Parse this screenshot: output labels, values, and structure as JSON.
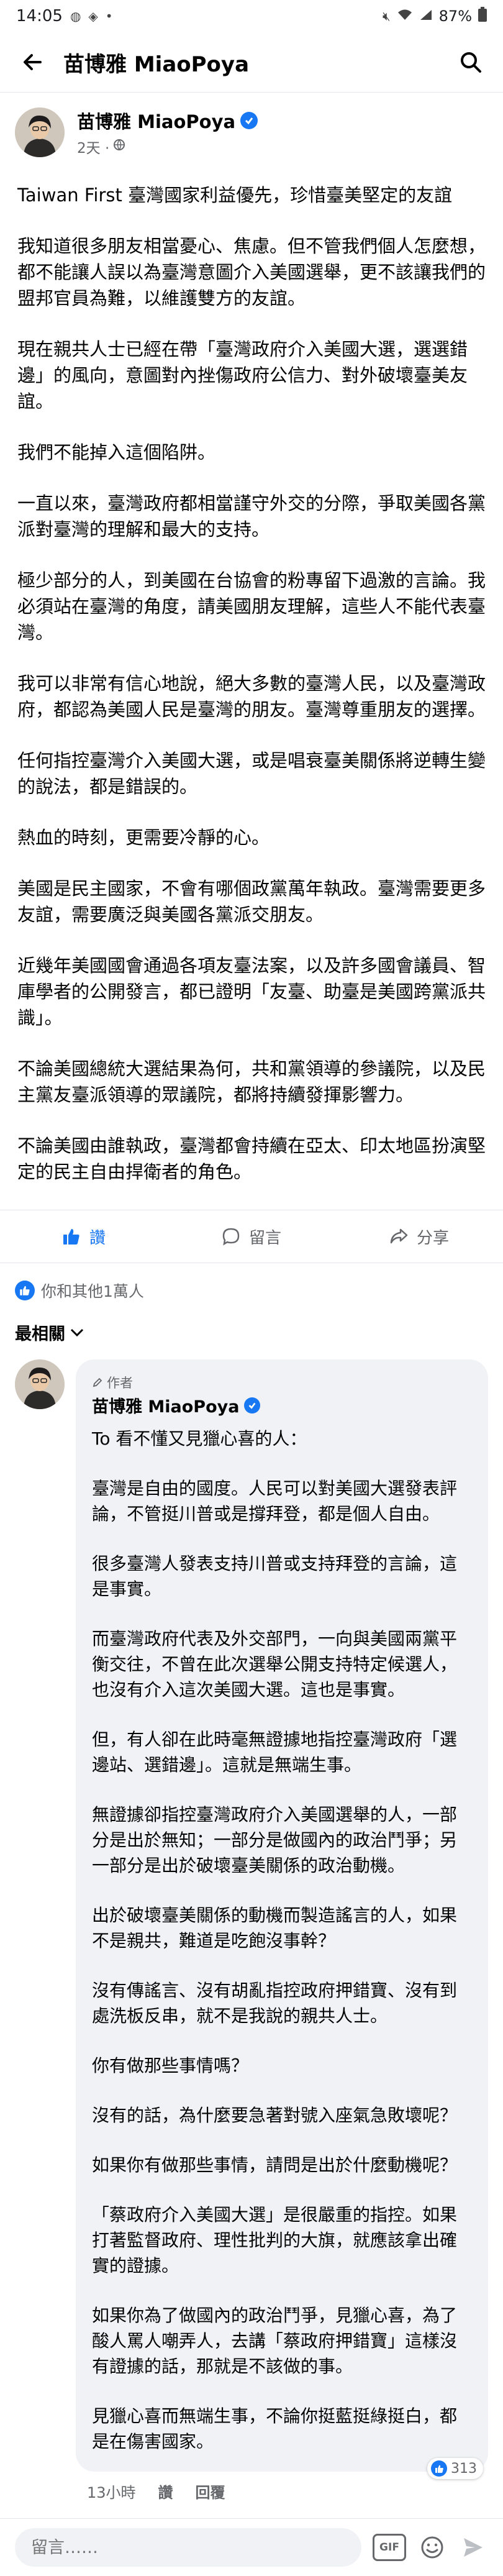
{
  "status_bar": {
    "time": "14:05",
    "battery": "87%"
  },
  "header": {
    "title": "苗博雅 MiaoPoya"
  },
  "post": {
    "author": "苗博雅 MiaoPoya",
    "time": "2天 ·",
    "paragraphs": [
      "Taiwan First 臺灣國家利益優先，珍惜臺美堅定的友誼",
      "我知道很多朋友相當憂心、焦慮。但不管我們個人怎麼想，都不能讓人誤以為臺灣意圖介入美國選舉，更不該讓我們的盟邦官員為難，以維護雙方的友誼。",
      "現在親共人士已經在帶「臺灣政府介入美國大選，選選錯邊」的風向，意圖對內挫傷政府公信力、對外破壞臺美友誼。",
      "我們不能掉入這個陷阱。",
      "一直以來，臺灣政府都相當謹守外交的分際，爭取美國各黨派對臺灣的理解和最大的支持。",
      "極少部分的人，到美國在台協會的粉專留下過激的言論。我必須站在臺灣的角度，請美國朋友理解，這些人不能代表臺灣。",
      "我可以非常有信心地說，絕大多數的臺灣人民，以及臺灣政府，都認為美國人民是臺灣的朋友。臺灣尊重朋友的選擇。",
      "任何指控臺灣介入美國大選，或是唱衰臺美關係將逆轉生變的說法，都是錯誤的。",
      "熱血的時刻，更需要冷靜的心。",
      "美國是民主國家，不會有哪個政黨萬年執政。臺灣需要更多友誼，需要廣泛與美國各黨派交朋友。",
      "近幾年美國國會通過各項友臺法案，以及許多國會議員、智庫學者的公開發言，都已證明「友臺、助臺是美國跨黨派共識」。",
      "不論美國總統大選結果為何，共和黨領導的參議院，以及民主黨友臺派領導的眾議院，都將持續發揮影響力。",
      "不論美國由誰執政，臺灣都會持續在亞太、印太地區扮演堅定的民主自由捍衛者的角色。"
    ]
  },
  "actions": {
    "like": "讚",
    "comment": "留言",
    "share": "分享"
  },
  "reactions": {
    "summary": "你和其他1萬人"
  },
  "sort": {
    "label": "最相關"
  },
  "comment": {
    "author_tag": "作者",
    "author": "苗博雅 MiaoPoya",
    "paragraphs": [
      "To 看不懂又見獵心喜的人：",
      "臺灣是自由的國度。人民可以對美國大選發表評論，不管挺川普或是撐拜登，都是個人自由。",
      "很多臺灣人發表支持川普或支持拜登的言論，這是事實。",
      "而臺灣政府代表及外交部門，一向與美國兩黨平衡交往，不曾在此次選舉公開支持特定候選人，也沒有介入這次美國大選。這也是事實。",
      "但，有人卻在此時毫無證據地指控臺灣政府「選邊站、選錯邊」。這就是無端生事。",
      "無證據卻指控臺灣政府介入美國選舉的人，一部分是出於無知；一部分是做國內的政治鬥爭；另一部分是出於破壞臺美關係的政治動機。",
      "出於破壞臺美關係的動機而製造謠言的人，如果不是親共，難道是吃飽沒事幹？",
      "沒有傳謠言、沒有胡亂指控政府押錯寶、沒有到處洗板反串，就不是我說的親共人士。",
      "你有做那些事情嗎？",
      "沒有的話，為什麼要急著對號入座氣急敗壞呢？",
      "如果你有做那些事情，請問是出於什麼動機呢？",
      "「蔡政府介入美國大選」是很嚴重的指控。如果打著監督政府、理性批判的大旗，就應該拿出確實的證據。",
      "如果你為了做國內的政治鬥爭，見獵心喜，為了酸人罵人嘲弄人，去講「蔡政府押錯寶」這樣沒有證據的話，那就是不該做的事。",
      "見獵心喜而無端生事，不論你挺藍挺綠挺白，都是在傷害國家。"
    ],
    "time": "13小時",
    "like_label": "讚",
    "reply_label": "回覆",
    "like_count": "313"
  },
  "composer": {
    "placeholder": "留言……",
    "gif_label": "GIF"
  },
  "colors": {
    "accent": "#1877f2",
    "muted": "#65676b",
    "bubble": "#f0f2f5"
  }
}
